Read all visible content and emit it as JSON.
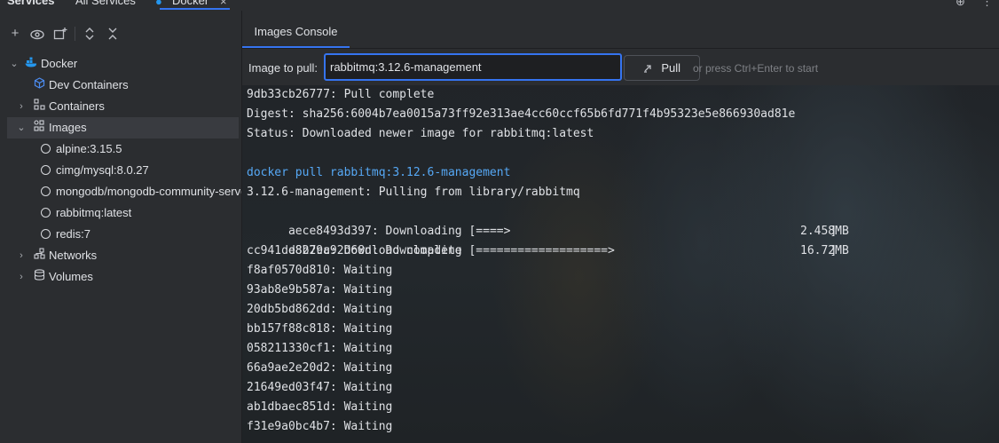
{
  "top_tabs": {
    "services": "Services",
    "all_services": "All Services",
    "docker": "Docker",
    "close": "×"
  },
  "toolbar": {
    "add": "+",
    "view": "👁",
    "new": "⊕",
    "expand": "⌃",
    "collapse": "✕"
  },
  "tree": {
    "docker": "Docker",
    "dev_containers": "Dev Containers",
    "containers": "Containers",
    "images": "Images",
    "image_items": [
      "alpine:3.15.5",
      "cimg/mysql:8.0.27",
      "mongodb/mongodb-community-server",
      "rabbitmq:latest",
      "redis:7"
    ],
    "networks": "Networks",
    "volumes": "Volumes"
  },
  "console_tab": "Images Console",
  "pull": {
    "label": "Image to pull:",
    "value": "rabbitmq:3.12.6-management",
    "button": "Pull",
    "hint": "or press Ctrl+Enter to start"
  },
  "console_lines": [
    "9db33cb26777: Pull complete",
    "Digest: sha256:6004b7ea0015a73ff92e313ae4cc60ccf65b6fd771f4b95323e5e866930ad81e",
    "Status: Downloaded newer image for rabbitmq:latest",
    "",
    "docker pull rabbitmq:3.12.6-management",
    "3.12.6-management: Pulling from library/rabbitmq",
    "aece8493d397: Downloading [====>                                              ]",
    "e8b79c92d68d: Downloading [===================>                               ]",
    "cc941dd822ca: Download complete",
    "f8af0570d810: Waiting",
    "93ab8e9b587a: Waiting",
    "20db5bd862dd: Waiting",
    "bb157f88c818: Waiting",
    "058211330cf1: Waiting",
    "66a9ae2e20d2: Waiting",
    "21649ed03f47: Waiting",
    "ab1dbaec851d: Waiting",
    "f31e9a0bc4b7: Waiting"
  ],
  "sizes": {
    "line6": "2.458MB",
    "line7": "16.72MB"
  },
  "colors": {
    "accent": "#3574f0",
    "command": "#56a8f5",
    "docker_blue": "#2496ed"
  }
}
